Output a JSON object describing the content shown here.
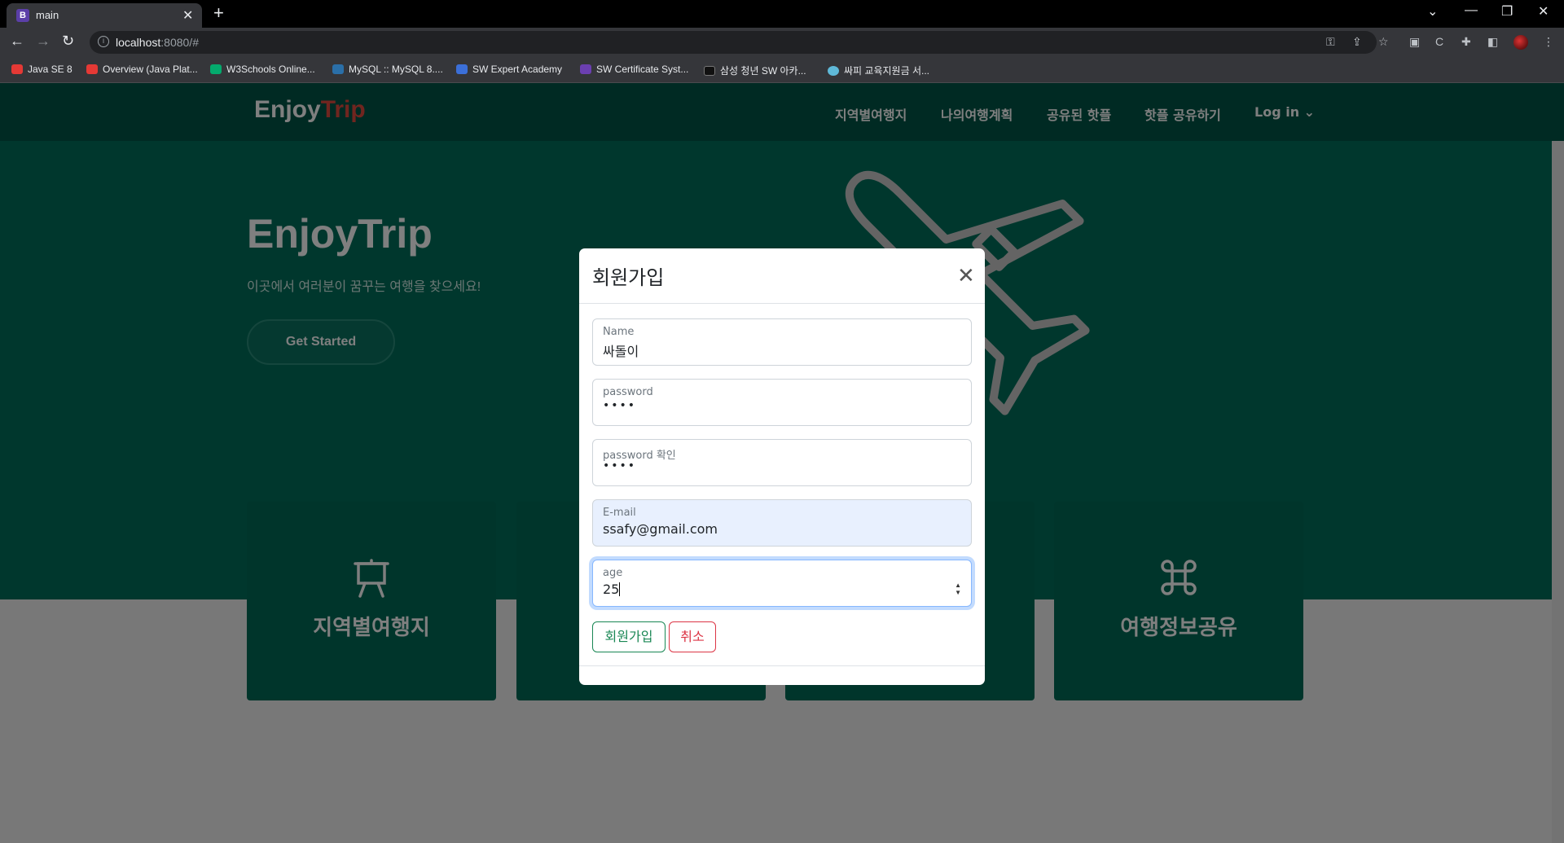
{
  "browser": {
    "tab_title": "main",
    "tab_favicon": "B",
    "url_host": "localhost",
    "url_rest": ":8080/#",
    "bookmarks": [
      {
        "label": "Java SE 8",
        "color": "#e53935"
      },
      {
        "label": "Overview (Java Plat...",
        "color": "#e53935"
      },
      {
        "label": "W3Schools Online...",
        "color": "#04aa6d"
      },
      {
        "label": "MySQL :: MySQL 8....",
        "color": "#2a6fa8"
      },
      {
        "label": "SW Expert Academy",
        "color": "#3b6fd8"
      },
      {
        "label": "SW Certificate Syst...",
        "color": "#6b3fb0"
      },
      {
        "label": "삼성 청년 SW 아카...",
        "color": "#111111"
      },
      {
        "label": "싸피 교육지원금 서...",
        "color": "#5fb9d8"
      }
    ]
  },
  "site": {
    "logo_enjoy": "Enjoy",
    "logo_trip": "Trip",
    "nav": [
      "지역별여행지",
      "나의여행계획",
      "공유된 핫플",
      "핫플 공유하기",
      "Log in ⌄"
    ],
    "hero_title": "EnjoyTrip",
    "hero_subtitle": "이곳에서 여러분이 꿈꾸는 여행을 찾으세요!",
    "hero_button": "Get Started",
    "cards": [
      "지역별여행지",
      "",
      "",
      "여행정보공유"
    ],
    "colors": {
      "hero": "#016e5b",
      "navbar": "#015546",
      "logo_trip": "#e04b3f"
    }
  },
  "modal": {
    "title": "회원가입",
    "fields": [
      {
        "label": "Name",
        "value": "싸돌이"
      },
      {
        "label": "password",
        "value": "••••"
      },
      {
        "label": "password 확인",
        "value": "••••"
      },
      {
        "label": "E-mail",
        "value": "ssafy@gmail.com"
      },
      {
        "label": "age",
        "value": "25"
      }
    ],
    "submit_label": "회원가입",
    "cancel_label": "취소"
  }
}
